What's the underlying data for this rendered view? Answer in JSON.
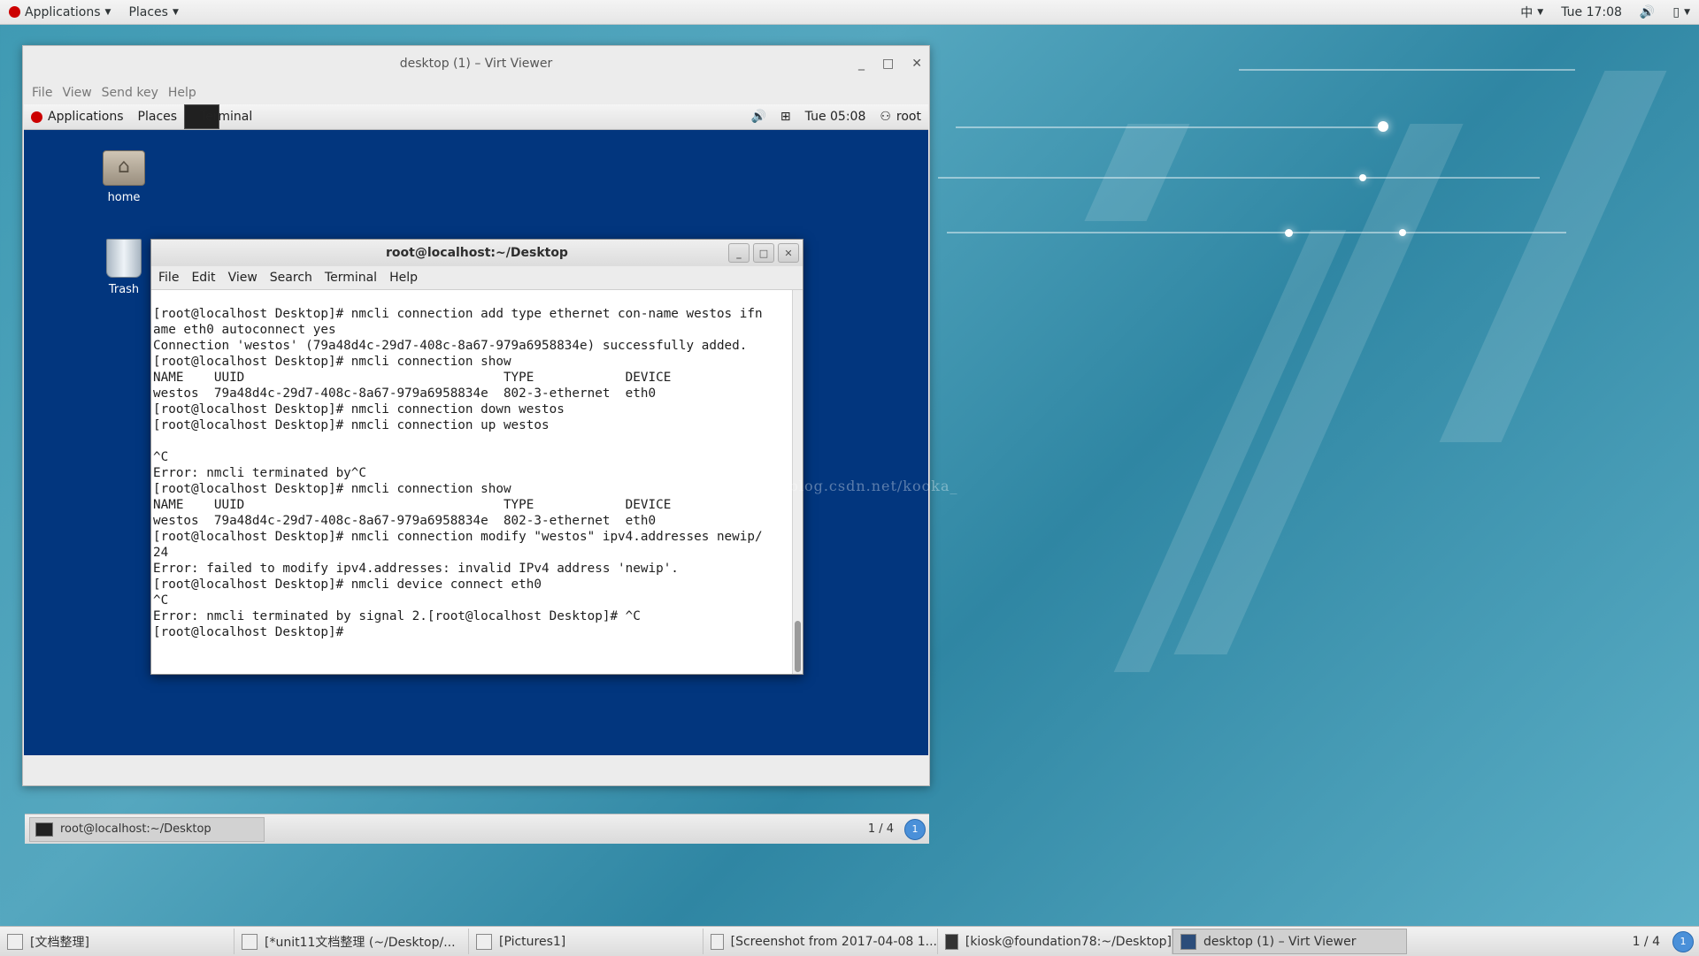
{
  "top_panel": {
    "applications": "Applications",
    "places": "Places",
    "input_method": "中",
    "clock": "Tue 17:08"
  },
  "virt_viewer": {
    "title": "desktop (1) – Virt Viewer",
    "menu": [
      "File",
      "View",
      "Send key",
      "Help"
    ]
  },
  "guest_panel": {
    "applications": "Applications",
    "places": "Places",
    "terminal_task": "Terminal",
    "clock": "Tue 05:08",
    "user": "root"
  },
  "desktop_icons": [
    {
      "label": "home"
    },
    {
      "label": "Trash"
    }
  ],
  "terminal": {
    "title": "root@localhost:~/Desktop",
    "menu": [
      "File",
      "Edit",
      "View",
      "Search",
      "Terminal",
      "Help"
    ],
    "lines": [
      "[root@localhost Desktop]# nmcli connection add type ethernet con-name westos ifn",
      "ame eth0 autoconnect yes",
      "Connection 'westos' (79a48d4c-29d7-408c-8a67-979a6958834e) successfully added.",
      "[root@localhost Desktop]# nmcli connection show",
      "NAME    UUID                                  TYPE            DEVICE",
      "westos  79a48d4c-29d7-408c-8a67-979a6958834e  802-3-ethernet  eth0",
      "[root@localhost Desktop]# nmcli connection down westos",
      "[root@localhost Desktop]# nmcli connection up westos",
      "",
      "^C",
      "Error: nmcli terminated by^C",
      "[root@localhost Desktop]# nmcli connection show",
      "NAME    UUID                                  TYPE            DEVICE",
      "westos  79a48d4c-29d7-408c-8a67-979a6958834e  802-3-ethernet  eth0",
      "[root@localhost Desktop]# nmcli connection modify \"westos\" ipv4.addresses newip/",
      "24",
      "Error: failed to modify ipv4.addresses: invalid IPv4 address 'newip'.",
      "[root@localhost Desktop]# nmcli device connect eth0",
      "^C",
      "Error: nmcli terminated by signal 2.[root@localhost Desktop]# ^C",
      "[root@localhost Desktop]# "
    ]
  },
  "watermark": "http://blog.csdn.net/kooka_",
  "guest_bottom": {
    "task": "root@localhost:~/Desktop",
    "workspace": "1 / 4",
    "badge": "1"
  },
  "host_taskbar": {
    "tasks": [
      {
        "label": "[文档整理]"
      },
      {
        "label": "[*unit11文档整理 (~/Desktop/..."
      },
      {
        "label": "[Pictures1]"
      },
      {
        "label": "[Screenshot from 2017-04-08 1..."
      },
      {
        "label": "[kiosk@foundation78:~/Desktop]"
      },
      {
        "label": "desktop (1) – Virt Viewer"
      }
    ],
    "workspace": "1 / 4",
    "badge": "1"
  }
}
